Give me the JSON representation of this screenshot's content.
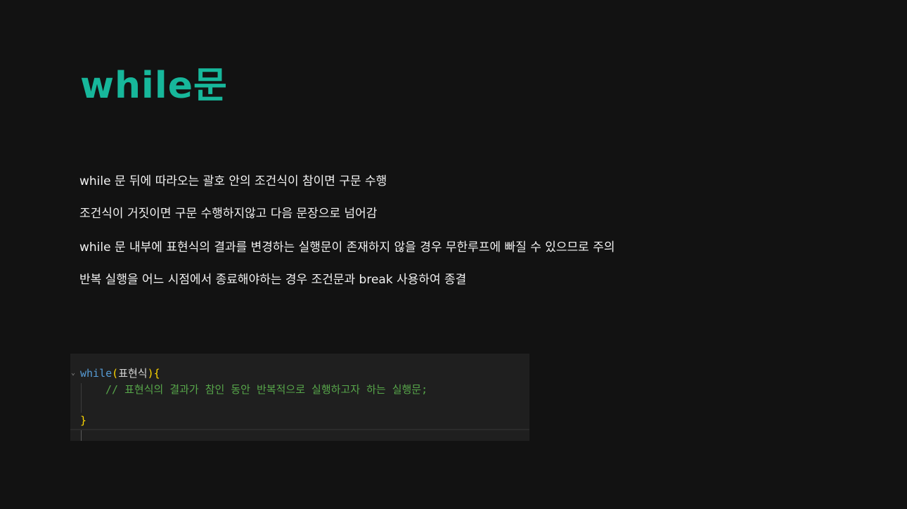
{
  "heading": "while문",
  "paragraphs": {
    "p1": "while 문 뒤에 따라오는 괄호 안의 조건식이 참이면 구문 수행",
    "p2": "조건식이 거짓이면 구문 수행하지않고 다음 문장으로 넘어감",
    "p3": " while 문 내부에 표현식의 결과를 변경하는 실행문이 존재하지 않을 경우 무한루프에 빠질 수 있으므로 주의",
    "p4": "반복 실행을 어느 시점에서 종료해야하는 경우 조건문과 break 사용하여 종결"
  },
  "code": {
    "keyword": "while",
    "open_paren": "(",
    "condition": "표현식",
    "close_paren_brace": "){",
    "comment": "// 표현식의 결과가 참인 동안 반복적으로 실행하고자 하는 실행문;",
    "close_brace": "}",
    "fold_marker": "⌄"
  },
  "colors": {
    "heading": "#17b79b",
    "background": "#121212",
    "code_background": "#1f1f1f",
    "keyword": "#569cd6",
    "comment": "#57a64a",
    "brace": "#ffd700"
  }
}
